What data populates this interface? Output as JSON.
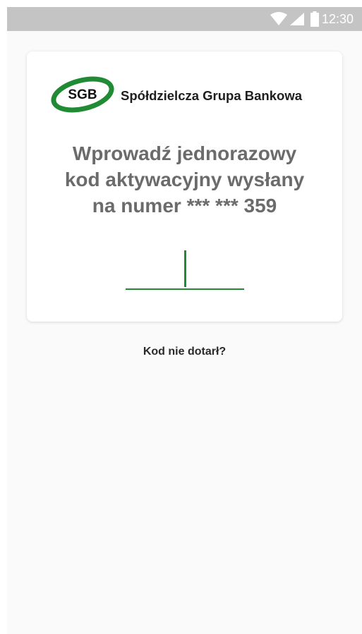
{
  "status_bar": {
    "time": "12:30",
    "icons": [
      "wifi-icon",
      "signal-icon",
      "battery-icon"
    ]
  },
  "logo": {
    "mark_text": "SGB",
    "name": "Spółdzielcza Grupa Bankowa"
  },
  "prompt": {
    "line1": "Wprowadź jednorazowy",
    "line2": "kod aktywacyjny wysłany",
    "line3": "na numer *** *** 359"
  },
  "code_input": {
    "value": ""
  },
  "resend_link": "Kod nie dotarł?",
  "colors": {
    "brand_green": "#208a35",
    "status_bar": "#c4c4c4",
    "prompt_text": "#6b6b6b",
    "background": "#fafafa"
  }
}
